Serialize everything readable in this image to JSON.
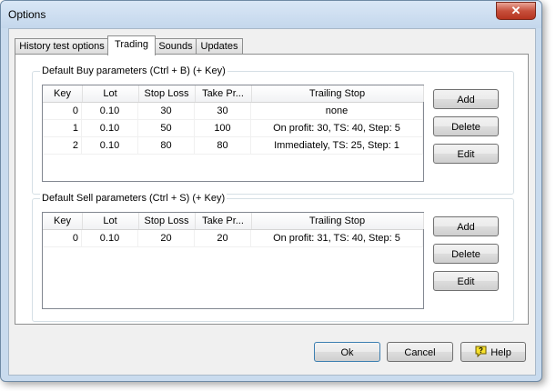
{
  "window": {
    "title": "Options",
    "close_symbol": "✕"
  },
  "tabs": [
    {
      "label": "History test options",
      "active": false
    },
    {
      "label": "Trading",
      "active": true
    },
    {
      "label": "Sounds",
      "active": false
    },
    {
      "label": "Updates",
      "active": false
    }
  ],
  "columns": {
    "key": "Key",
    "lot": "Lot",
    "stop_loss": "Stop Loss",
    "take_profit": "Take Pr...",
    "trailing_stop": "Trailing Stop"
  },
  "buy": {
    "label": "Default Buy parameters (Ctrl + B) (+ Key)",
    "rows": [
      {
        "key": "0",
        "lot": "0.10",
        "sl": "30",
        "tp": "30",
        "ts": "none"
      },
      {
        "key": "1",
        "lot": "0.10",
        "sl": "50",
        "tp": "100",
        "ts": "On profit: 30, TS: 40, Step: 5"
      },
      {
        "key": "2",
        "lot": "0.10",
        "sl": "80",
        "tp": "80",
        "ts": "Immediately, TS: 25, Step: 1"
      }
    ],
    "buttons": {
      "add": "Add",
      "delete": "Delete",
      "edit": "Edit"
    }
  },
  "sell": {
    "label": "Default Sell parameters (Ctrl + S) (+ Key)",
    "rows": [
      {
        "key": "0",
        "lot": "0.10",
        "sl": "20",
        "tp": "20",
        "ts": "On profit: 31, TS: 40, Step: 5"
      }
    ],
    "buttons": {
      "add": "Add",
      "delete": "Delete",
      "edit": "Edit"
    }
  },
  "footer": {
    "ok": "Ok",
    "cancel": "Cancel",
    "help": "Help"
  },
  "icons": {
    "help": "help-question-icon",
    "close": "close-icon"
  }
}
